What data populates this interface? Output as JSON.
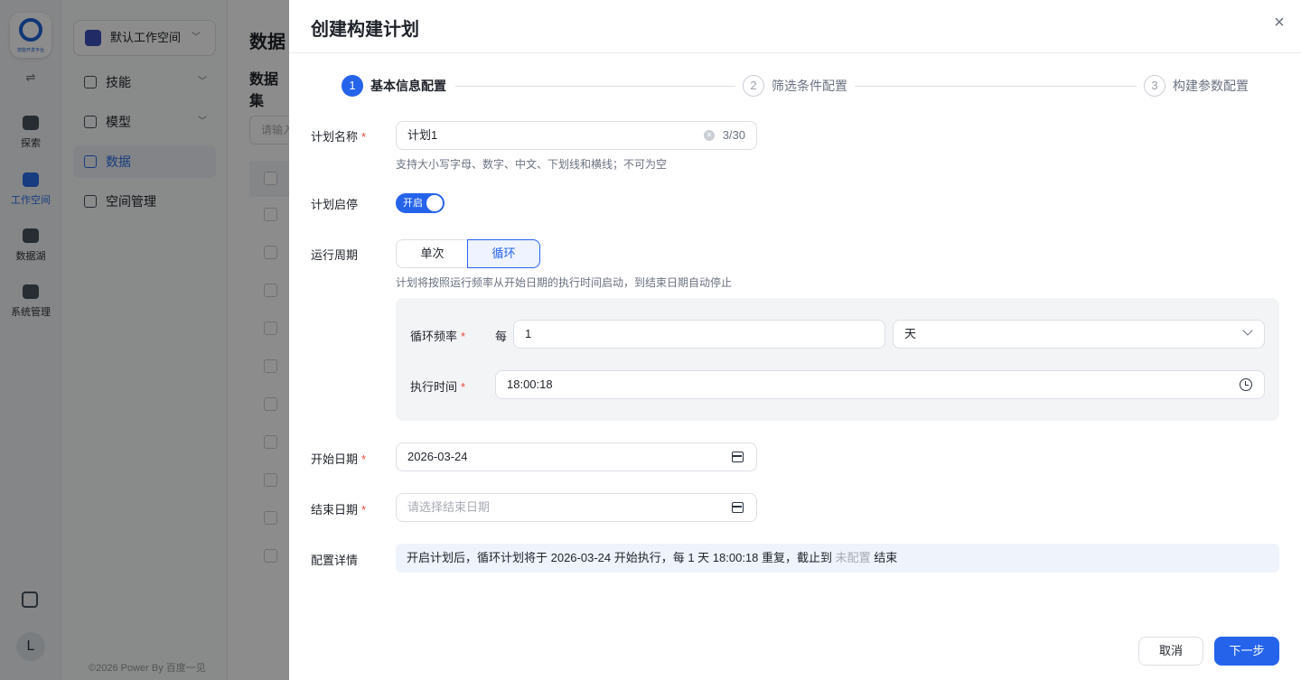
{
  "rail": {
    "logo_caption": "技能开发平台",
    "toggle": "⇌",
    "items": [
      {
        "label": "探索",
        "icon": "planet-icon"
      },
      {
        "label": "工作空间",
        "icon": "folder-terminal-icon"
      },
      {
        "label": "数据湖",
        "icon": "database-icon"
      },
      {
        "label": "系统管理",
        "icon": "server-icon"
      }
    ],
    "avatar": "L"
  },
  "nav": {
    "workspace": "默认工作空间",
    "items": [
      {
        "label": "技能"
      },
      {
        "label": "模型"
      },
      {
        "label": "数据"
      },
      {
        "label": "空间管理"
      }
    ],
    "copyright": "©2026 Power By 百度一见"
  },
  "main": {
    "title": "数据",
    "subtitle": "数据集",
    "search_placeholder": "请输入"
  },
  "drawer": {
    "title": "创建构建计划",
    "close": "×",
    "steps": [
      {
        "num": "1",
        "label": "基本信息配置",
        "active": true
      },
      {
        "num": "2",
        "label": "筛选条件配置",
        "active": false
      },
      {
        "num": "3",
        "label": "构建参数配置",
        "active": false
      }
    ],
    "form": {
      "name_label": "计划名称",
      "name_value": "计划1",
      "name_count": "3/30",
      "name_hint": "支持大小写字母、数字、中文、下划线和横线；不可为空",
      "enable_label": "计划启停",
      "enable_text": "开启",
      "cycle_label": "运行周期",
      "cycle_options": [
        "单次",
        "循环"
      ],
      "cycle_selected": "循环",
      "cycle_hint": "计划将按照运行频率从开始日期的执行时间启动，到结束日期自动停止",
      "freq_label": "循环频率",
      "freq_every": "每",
      "freq_value": "1",
      "freq_unit": "天",
      "time_label": "执行时间",
      "time_value": "18:00:18",
      "start_label": "开始日期",
      "start_value": "2026-03-24",
      "end_label": "结束日期",
      "end_placeholder": "请选择结束日期",
      "detail_label": "配置详情",
      "detail_prefix": "开启计划后，循环计划将于 2026-03-24 开始执行，每 1 天 18:00:18 重复，截止到",
      "detail_muted": "未配置",
      "detail_suffix": "结束"
    },
    "buttons": {
      "cancel": "取消",
      "next": "下一步"
    }
  },
  "colors": {
    "primary": "#2563eb",
    "required": "#e5483d",
    "overlay": "rgba(0,0,0,0.45)"
  }
}
